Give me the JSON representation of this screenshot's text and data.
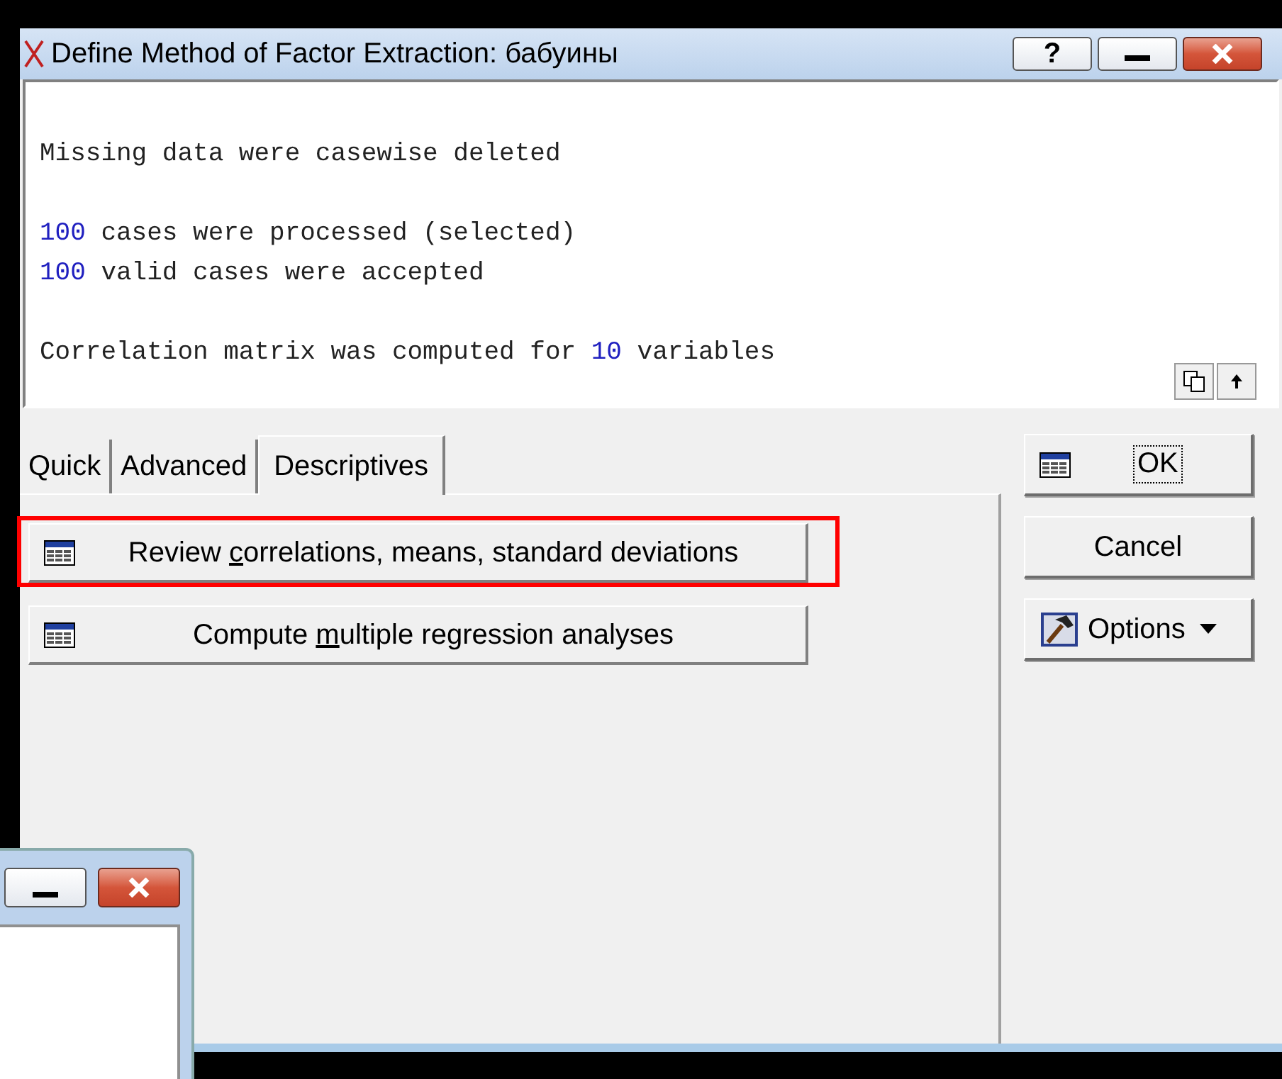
{
  "window": {
    "title": "Define Method of Factor Extraction: бабуины",
    "controls": [
      {
        "kind": "help",
        "label": "?"
      },
      {
        "kind": "minimize"
      },
      {
        "kind": "close"
      }
    ]
  },
  "output": {
    "lines": [
      {
        "segments": [
          {
            "kind": "text",
            "text": "Missing data were casewise deleted"
          }
        ]
      },
      {
        "kind": "blank"
      },
      {
        "segments": [
          {
            "kind": "number",
            "text": "100"
          },
          {
            "kind": "text",
            "text": " cases were processed (selected)"
          }
        ]
      },
      {
        "segments": [
          {
            "kind": "number",
            "text": "100"
          },
          {
            "kind": "text",
            "text": " valid cases were accepted"
          }
        ]
      },
      {
        "kind": "blank"
      },
      {
        "segments": [
          {
            "kind": "text",
            "text": "Correlation matrix was computed for "
          },
          {
            "kind": "number",
            "text": "10"
          },
          {
            "kind": "text",
            "text": " variables"
          }
        ]
      }
    ]
  },
  "tabs": [
    {
      "label": "Quick",
      "selected": false
    },
    {
      "label": "Advanced",
      "selected": false
    },
    {
      "label": "Descriptives",
      "selected": true
    }
  ],
  "actions": [
    {
      "parts": [
        "Review ",
        "c",
        "orrelations, means, standard deviations"
      ],
      "highlighted": true
    },
    {
      "parts": [
        "Compute ",
        "m",
        "ultiple regression analyses"
      ],
      "highlighted": false
    }
  ],
  "side_buttons": [
    {
      "kind": "ok",
      "label": "OK"
    },
    {
      "kind": "cancel",
      "label": "Cancel"
    },
    {
      "kind": "options",
      "label": "Options"
    }
  ],
  "background_window": {
    "controls": [
      {
        "kind": "minimize"
      },
      {
        "kind": "close"
      }
    ]
  }
}
